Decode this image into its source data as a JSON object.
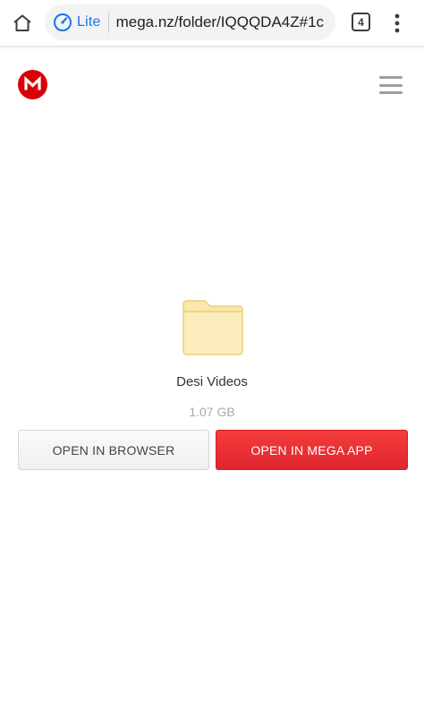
{
  "browser": {
    "lite_label": "Lite",
    "url": "mega.nz/folder/IQQQDA4Z#1c",
    "tab_count": "4",
    "accent_color": "#1a73e8"
  },
  "header": {
    "logo_letter": "M",
    "logo_color": "#d90007",
    "menu_icon": "hamburger-icon"
  },
  "folder": {
    "name": "Desi Videos",
    "size": "1.07 GB",
    "icon_color": "#fbe9b3"
  },
  "actions": {
    "open_browser_label": "OPEN IN BROWSER",
    "open_app_label": "OPEN IN MEGA APP",
    "app_button_color": "#ee3338"
  }
}
